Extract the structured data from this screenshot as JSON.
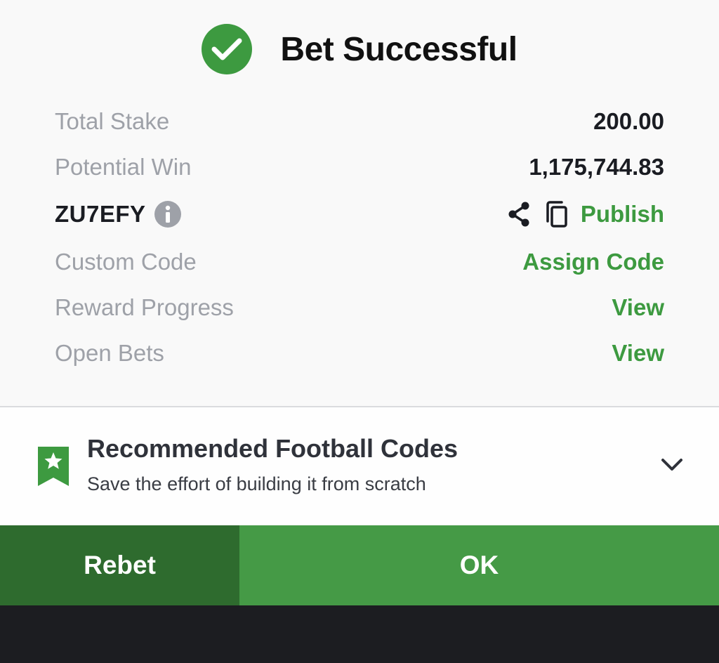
{
  "header": {
    "title": "Bet Successful"
  },
  "summary": {
    "total_stake_label": "Total Stake",
    "total_stake_value": "200.00",
    "potential_win_label": "Potential Win",
    "potential_win_value": "1,175,744.83",
    "booking_code": "ZU7EFY",
    "publish_label": "Publish",
    "custom_code_label": "Custom Code",
    "assign_code_label": "Assign Code",
    "reward_progress_label": "Reward Progress",
    "reward_progress_link": "View",
    "open_bets_label": "Open Bets",
    "open_bets_link": "View"
  },
  "recommended": {
    "title": "Recommended Football Codes",
    "subtitle": "Save the effort of building it from scratch"
  },
  "actions": {
    "rebet_label": "Rebet",
    "ok_label": "OK"
  },
  "icons": {
    "success": "check-circle-icon",
    "info": "info-icon",
    "share": "share-icon",
    "copy": "copy-icon",
    "bookmark": "bookmark-star-icon",
    "expand": "chevron-down-icon"
  },
  "colors": {
    "accent_green": "#3d9a40",
    "ok_button": "#459a46",
    "rebet_button": "#2e6b2e",
    "label_gray": "#9ea1a8",
    "dark_bar": "#1c1d21"
  }
}
